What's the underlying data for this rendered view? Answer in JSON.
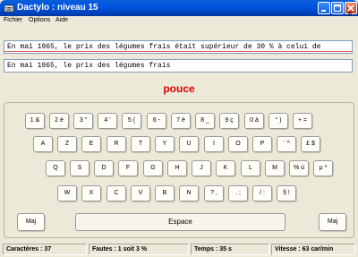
{
  "window": {
    "title": "Dactylo : niveau 15"
  },
  "menu": {
    "items": [
      "Fichier",
      "Options",
      "Aide"
    ],
    "right_label": "F"
  },
  "exercise": {
    "model_text": "En mai 1965, le prix des légumes frais était supérieur de 30 % à celui de",
    "typed_text": "En mai 1965, le prix des légumes frais",
    "error_word": "pouce"
  },
  "keyboard": {
    "rows": [
      [
        "1 &",
        "2 é",
        "3 \"",
        "4 '",
        "5 (",
        "6 -",
        "7 è",
        "8 _",
        "9 ç",
        "0 à",
        "° )",
        "+ ="
      ],
      [
        "A",
        "Z",
        "E",
        "R",
        "T",
        "Y",
        "U",
        "I",
        "O",
        "P",
        "¨ ^",
        "£ $"
      ],
      [
        "Q",
        "S",
        "D",
        "F",
        "G",
        "H",
        "J",
        "K",
        "L",
        "M",
        "% ù",
        "µ *"
      ],
      [
        "W",
        "X",
        "C",
        "V",
        "B",
        "N",
        "? ,",
        ". ;",
        "/ :",
        "§ !"
      ]
    ],
    "shift_left": "Maj",
    "shift_right": "Maj",
    "space": "Espace"
  },
  "status": {
    "characters": "Caractères : 37",
    "errors": "Fautes : 1 soit 3 %",
    "time": "Temps : 35 s",
    "speed": "Vitesse : 63 car/min"
  },
  "colors": {
    "titlebar": "#0054e3",
    "error": "#e00000",
    "window_bg": "#ece9d8"
  }
}
